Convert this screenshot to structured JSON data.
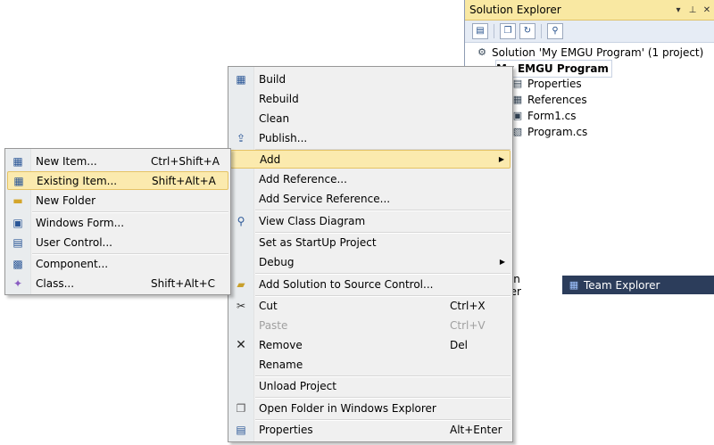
{
  "solution_explorer": {
    "title": "Solution Explorer",
    "pin_label": "▾ ꟼ ✕",
    "solution": "Solution 'My EMGU Program' (1 project)",
    "project": "My EMGU Program",
    "items": [
      "Properties",
      "References",
      "Form1.cs",
      "Program.cs"
    ],
    "tabs": [
      "Solution Explorer",
      "Team Explorer"
    ]
  },
  "context_menu": {
    "items": [
      {
        "label": "Build",
        "icon": "build-icon"
      },
      {
        "label": "Rebuild"
      },
      {
        "label": "Clean"
      },
      {
        "label": "Publish...",
        "icon": "publish-icon"
      },
      {
        "label": "Add",
        "submenu": true,
        "highlighted": true
      },
      {
        "label": "Add Reference..."
      },
      {
        "label": "Add Service Reference..."
      },
      {
        "label": "View Class Diagram",
        "icon": "class-diagram-icon"
      },
      {
        "label": "Set as StartUp Project"
      },
      {
        "label": "Debug",
        "submenu": true
      },
      {
        "label": "Add Solution to Source Control...",
        "icon": "source-control-icon"
      },
      {
        "label": "Cut",
        "shortcut": "Ctrl+X",
        "icon": "cut-icon"
      },
      {
        "label": "Paste",
        "shortcut": "Ctrl+V",
        "disabled": true
      },
      {
        "label": "Remove",
        "shortcut": "Del",
        "icon": "remove-icon"
      },
      {
        "label": "Rename"
      },
      {
        "label": "Unload Project"
      },
      {
        "label": "Open Folder in Windows Explorer",
        "icon": "open-folder-icon"
      },
      {
        "label": "Properties",
        "shortcut": "Alt+Enter",
        "icon": "properties-icon"
      }
    ]
  },
  "add_submenu": {
    "items": [
      {
        "label": "New Item...",
        "shortcut": "Ctrl+Shift+A",
        "icon": "new-item-icon"
      },
      {
        "label": "Existing Item...",
        "shortcut": "Shift+Alt+A",
        "icon": "existing-item-icon",
        "highlighted": true
      },
      {
        "label": "New Folder",
        "icon": "new-folder-icon"
      },
      {
        "label": "Windows Form...",
        "icon": "windows-form-icon"
      },
      {
        "label": "User Control...",
        "icon": "user-control-icon"
      },
      {
        "label": "Component...",
        "icon": "component-icon"
      },
      {
        "label": "Class...",
        "shortcut": "Shift+Alt+C",
        "icon": "class-icon"
      }
    ]
  },
  "colors": {
    "highlight": "#fbeaae",
    "title_bar": "#f9e8a2",
    "tab_strip": "#2c3d5b"
  }
}
